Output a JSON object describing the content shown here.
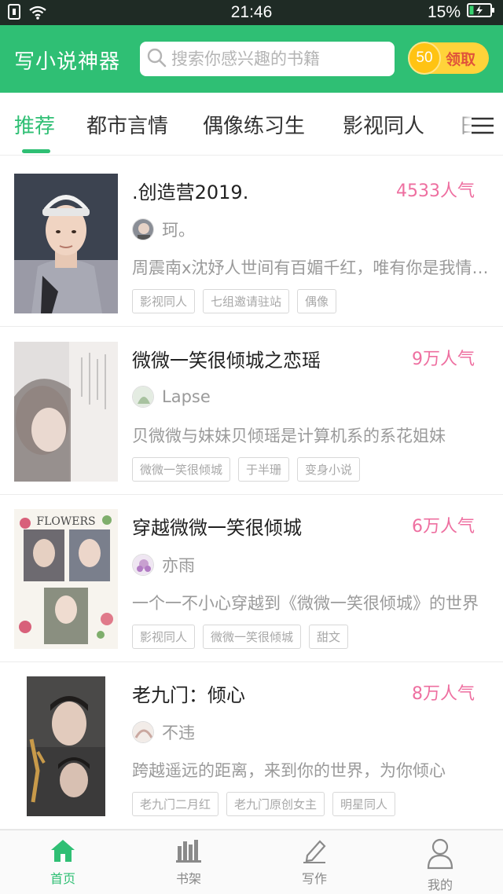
{
  "status_bar": {
    "time": "21:46",
    "battery": "15%",
    "icons": [
      "notification-icon",
      "wifi-icon",
      "battery-charging-icon"
    ]
  },
  "header": {
    "title": "写小说神器",
    "search_placeholder": "搜索你感兴趣的书籍",
    "reward": {
      "coin_value": "50",
      "label": "领取"
    }
  },
  "tabs": [
    {
      "label": "推荐",
      "active": true
    },
    {
      "label": "都市言情",
      "active": false
    },
    {
      "label": "偶像练习生",
      "active": false
    },
    {
      "label": "影视同人",
      "active": false
    },
    {
      "label": "日",
      "active": false
    }
  ],
  "books": [
    {
      "title": ".创造营2019.",
      "popularity": "4533人气",
      "author": "珂。",
      "description": "周震南x沈妤人世间有百媚千红，唯有你是我情之所钟",
      "tags": [
        "影视同人",
        "七组邀请驻站",
        "偶像"
      ]
    },
    {
      "title": "微微一笑很倾城之恋瑶",
      "popularity": "9万人气",
      "author": "Lapse",
      "description": "贝微微与妹妹贝倾瑶是计算机系的系花姐妹",
      "tags": [
        "微微一笑很倾城",
        "于半珊",
        "变身小说"
      ]
    },
    {
      "title": "穿越微微一笑很倾城",
      "popularity": "6万人气",
      "author": "亦雨",
      "description": "一个一不小心穿越到《微微一笑很倾城》的世界",
      "tags": [
        "影视同人",
        "微微一笑很倾城",
        "甜文"
      ]
    },
    {
      "title": "老九门：倾心",
      "popularity": "8万人气",
      "author": "不违",
      "description": "跨越遥远的距离，来到你的世界，为你倾心",
      "tags": [
        "老九门二月红",
        "老九门原创女主",
        "明星同人"
      ]
    }
  ],
  "cover_text": {
    "book3": "FLOWERS"
  },
  "bottom_nav": [
    {
      "label": "首页",
      "icon": "home-icon",
      "active": true
    },
    {
      "label": "书架",
      "icon": "bookshelf-icon",
      "active": false
    },
    {
      "label": "写作",
      "icon": "pen-icon",
      "active": false
    },
    {
      "label": "我的",
      "icon": "profile-icon",
      "active": false
    }
  ],
  "colors": {
    "brand_green": "#2fbf74",
    "popularity_pink": "#ee6fa0",
    "reward_yellow": "#ffd33a"
  }
}
